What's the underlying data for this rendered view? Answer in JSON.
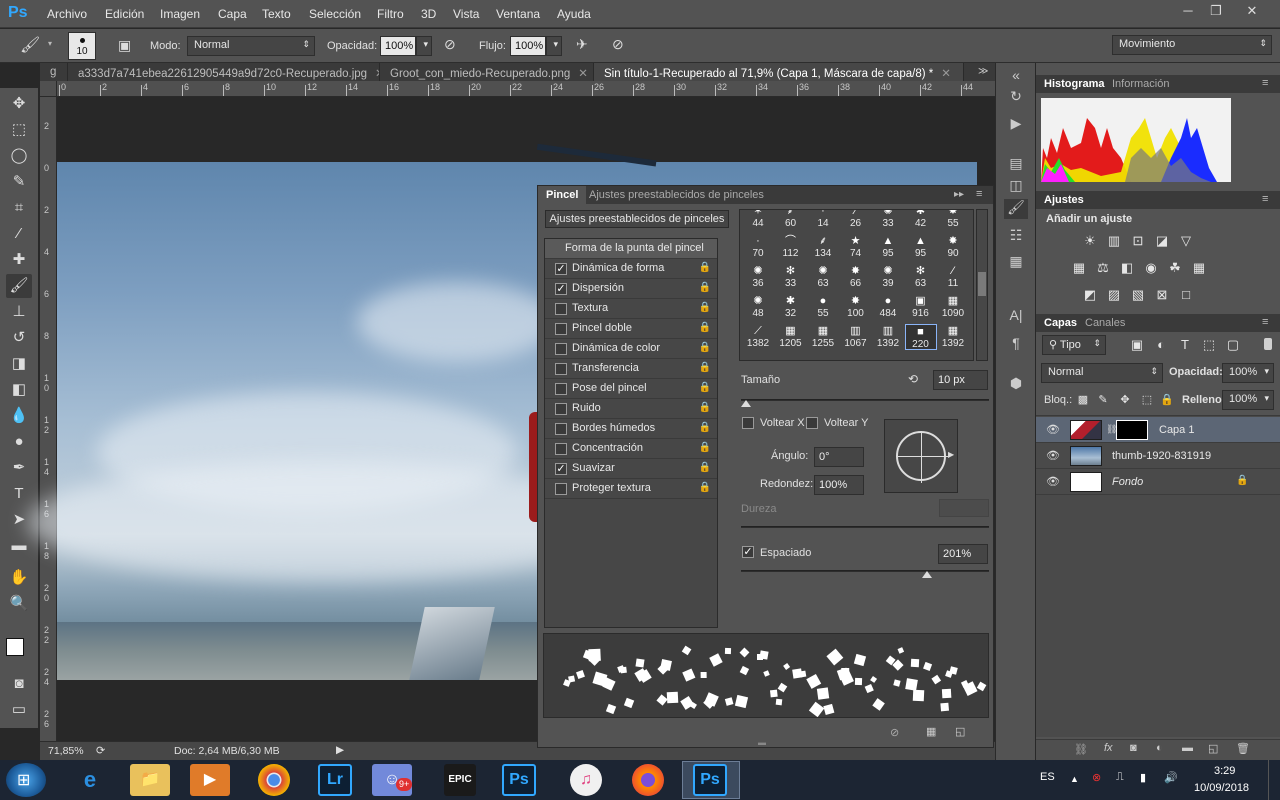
{
  "app": {
    "logo": "Ps"
  },
  "menu": [
    "Archivo",
    "Edición",
    "Imagen",
    "Capa",
    "Texto",
    "Selección",
    "Filtro",
    "3D",
    "Vista",
    "Ventana",
    "Ayuda"
  ],
  "options": {
    "brush_size": "10",
    "mode_label": "Modo:",
    "mode_value": "Normal",
    "opacity_label": "Opacidad:",
    "opacity_value": "100%",
    "flow_label": "Flujo:",
    "flow_value": "100%",
    "workspace": "Movimiento"
  },
  "tabs": [
    {
      "label": "g"
    },
    {
      "label": "a333d7a741ebea22612905449a9d72c0-Recuperado.jpg"
    },
    {
      "label": "Groot_con_miedo-Recuperado.png"
    },
    {
      "label": "Sin título-1-Recuperado al 71,9% (Capa 1, Máscara de capa/8) *"
    }
  ],
  "ruler_h": [
    "0",
    "2",
    "4",
    "6",
    "8",
    "10",
    "12",
    "14",
    "16",
    "18",
    "20",
    "22",
    "24",
    "26",
    "28",
    "30",
    "32",
    "34",
    "36",
    "38",
    "40",
    "42",
    "44"
  ],
  "ruler_v": [
    "2",
    "0",
    "2",
    "4",
    "6",
    "8",
    "1\n0",
    "1\n2",
    "1\n4",
    "1\n6",
    "1\n8",
    "2\n0",
    "2\n2",
    "2\n4",
    "2\n6"
  ],
  "status": {
    "zoom": "71,85%",
    "doc": "Doc: 2,64 MB/6,30 MB"
  },
  "brush_panel": {
    "tab_active": "Pincel",
    "tab_other": "Ajustes preestablecidos de pinceles",
    "preset_button": "Ajustes preestablecidos de pinceles",
    "tip_shape": "Forma de la punta del pincel",
    "options": [
      {
        "label": "Dinámica de forma",
        "checked": true
      },
      {
        "label": "Dispersión",
        "checked": true
      },
      {
        "label": "Textura",
        "checked": false
      },
      {
        "label": "Pincel doble",
        "checked": false
      },
      {
        "label": "Dinámica de color",
        "checked": false
      },
      {
        "label": "Transferencia",
        "checked": false
      },
      {
        "label": "Pose del pincel",
        "checked": false
      },
      {
        "label": "Ruido",
        "checked": false
      },
      {
        "label": "Bordes húmedos",
        "checked": false
      },
      {
        "label": "Concentración",
        "checked": false
      },
      {
        "label": "Suavizar",
        "checked": true
      },
      {
        "label": "Proteger textura",
        "checked": false
      }
    ],
    "brush_sizes": [
      "44",
      "60",
      "14",
      "26",
      "33",
      "42",
      "55",
      "70",
      "112",
      "134",
      "74",
      "95",
      "95",
      "90",
      "36",
      "33",
      "63",
      "66",
      "39",
      "63",
      "11",
      "48",
      "32",
      "55",
      "100",
      "484",
      "916",
      "1090",
      "1382",
      "1205",
      "1255",
      "1067",
      "1392",
      "220",
      "1392"
    ],
    "selected_brush": "220",
    "size_label": "Tamaño",
    "size_value": "10 px",
    "flip_x": "Voltear X",
    "flip_y": "Voltear Y",
    "angle_label": "Ángulo:",
    "angle_value": "0°",
    "round_label": "Redondez:",
    "round_value": "100%",
    "hardness_label": "Dureza",
    "spacing_label": "Espaciado",
    "spacing_value": "201%",
    "spacing_checked": true,
    "size_level_pct": 2,
    "spacing_level_pct": 75
  },
  "right_panel": {
    "histo_tab": "Histograma",
    "info_tab": "Información",
    "adjust_tab": "Ajustes",
    "adjust_title": "Añadir un ajuste",
    "layers_tab": "Capas",
    "channels_tab": "Canales",
    "kind": "Tipo",
    "blend": "Normal",
    "opacity_label": "Opacidad:",
    "opacity_value": "100%",
    "lock_label": "Bloq.:",
    "fill_label": "Relleno:",
    "fill_value": "100%",
    "layers": [
      {
        "name": "Capa 1",
        "selected": true
      },
      {
        "name": "thumb-1920-831919",
        "selected": false
      },
      {
        "name": "Fondo",
        "selected": false
      }
    ]
  },
  "taskbar": {
    "lang": "ES",
    "time": "3:29",
    "date": "10/09/2018",
    "discord_badge": "9+",
    "epic_label": "EPIC"
  }
}
